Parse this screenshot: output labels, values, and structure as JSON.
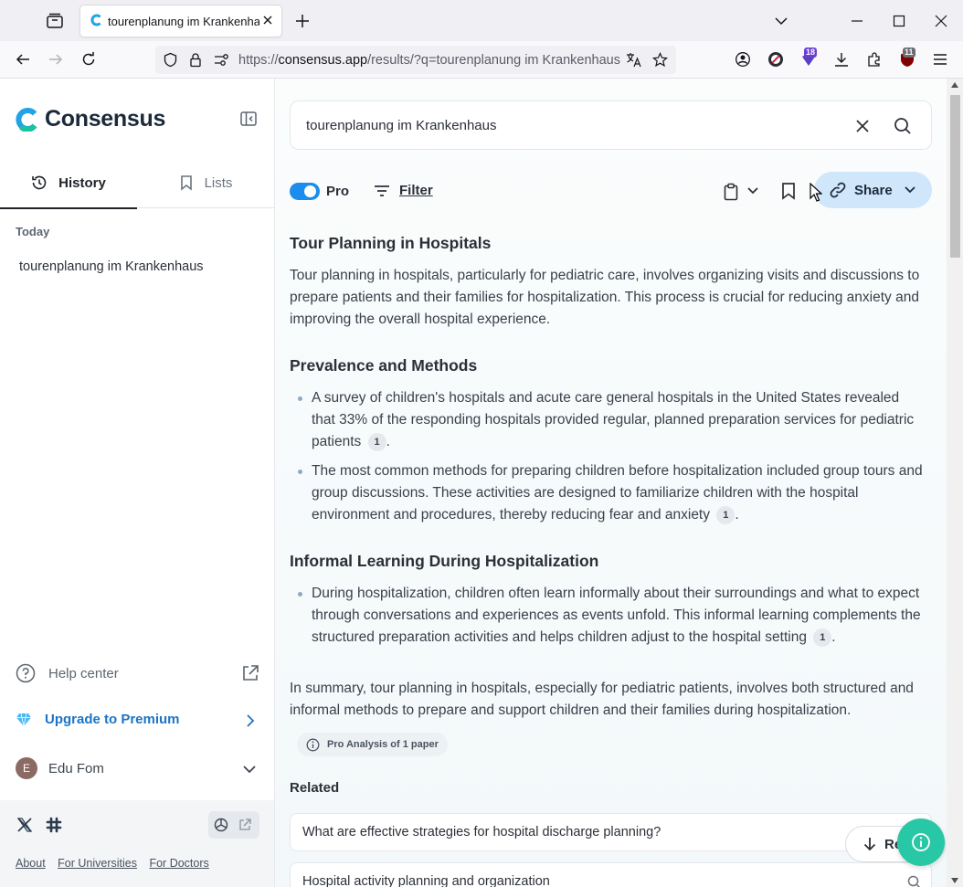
{
  "browser": {
    "tab_title": "tourenplanung im Krankenhaus",
    "url_prefix": "https://",
    "url_domain": "consensus.app",
    "url_rest": "/results/?q=tourenplanung im Krankenhaus &",
    "ext_badge_purple": "18",
    "ext_badge_red": "11"
  },
  "sidebar": {
    "logo": "Consensus",
    "tabs": [
      {
        "label": "History",
        "icon": "history-icon",
        "active": true
      },
      {
        "label": "Lists",
        "icon": "bookmark-icon",
        "active": false
      }
    ],
    "section_today": "Today",
    "history_items": [
      "tourenplanung im Krankenhaus"
    ],
    "help_center": "Help center",
    "upgrade": "Upgrade to Premium",
    "user_initial": "E",
    "user_name": "Edu Fom",
    "footer_links": [
      "About",
      "For Universities",
      "For Doctors"
    ]
  },
  "search": {
    "query": "tourenplanung im Krankenhaus"
  },
  "toolbar": {
    "pro_label": "Pro",
    "pro_enabled": true,
    "filter_label": "Filter",
    "share_label": "Share"
  },
  "answer": {
    "sections": [
      {
        "heading": "Tour Planning in Hospitals",
        "paragraph": "Tour planning in hospitals, particularly for pediatric care, involves organizing visits and discussions to prepare patients and their families for hospitalization. This process is crucial for reducing anxiety and improving the overall hospital experience."
      },
      {
        "heading": "Prevalence and Methods",
        "bullets": [
          {
            "text": "A survey of children's hospitals and acute care general hospitals in the United States revealed that 33% of the responding hospitals provided regular, planned preparation services for pediatric patients",
            "cite": "1"
          },
          {
            "text": "The most common methods for preparing children before hospitalization included group tours and group discussions. These activities are designed to familiarize children with the hospital environment and procedures, thereby reducing fear and anxiety",
            "cite": "1"
          }
        ]
      },
      {
        "heading": "Informal Learning During Hospitalization",
        "bullets": [
          {
            "text": "During hospitalization, children often learn informally about their surroundings and what to expect through conversations and experiences as events unfold. This informal learning complements the structured preparation activities and helps children adjust to the hospital setting",
            "cite": "1"
          }
        ]
      }
    ],
    "summary": "In summary, tour planning in hospitals, especially for pediatric patients, involves both structured and informal methods to prepare and support children and their families during hospitalization.",
    "pro_analysis": "Pro Analysis of 1 paper"
  },
  "related": {
    "heading": "Related",
    "items": [
      "What are effective strategies for hospital discharge planning?",
      "Hospital activity planning and organization"
    ]
  },
  "read_button": "Re",
  "colors": {
    "accent_blue": "#1a8dee",
    "share_bg": "#cfe6fb",
    "premium_blue": "#1b74c7",
    "fab_green": "#28c7a5"
  }
}
